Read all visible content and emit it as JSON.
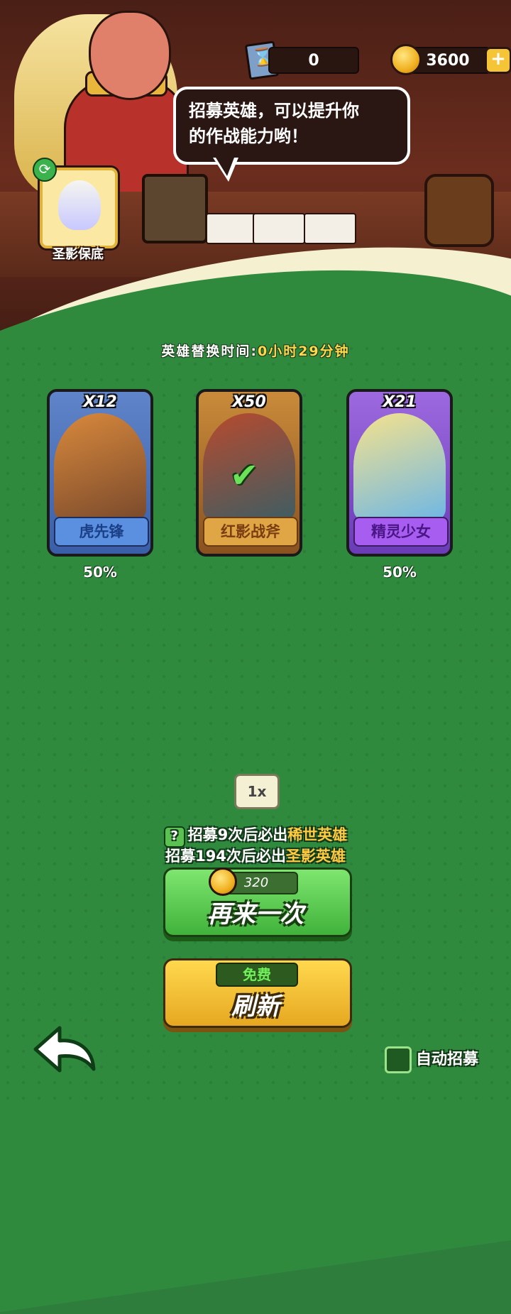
{
  "currency": {
    "tickets": "0",
    "coins": "3600",
    "add_label": "+"
  },
  "npc_speech": {
    "line1": "招募英雄，可以提升你",
    "line2": "的作战能力哟！"
  },
  "guarantee": {
    "label": "圣影保底"
  },
  "timer": {
    "label": "英雄替换时间:",
    "value": "0小时29分钟"
  },
  "heroes": [
    {
      "count": "X12",
      "name": "虎先锋",
      "rate": "50%",
      "color": "#5b90e0"
    },
    {
      "count": "X50",
      "name": "红影战斧",
      "rate": "",
      "color": "#e0a646",
      "selected": true
    },
    {
      "count": "X21",
      "name": "精灵少女",
      "rate": "50%",
      "color": "#a65df0"
    }
  ],
  "multiplier": "1x",
  "pity": {
    "line1_prefix": "招募9次后必出",
    "line1_highlight": "稀世英雄",
    "line2_prefix": "招募194次后必出",
    "line2_highlight": "圣影英雄"
  },
  "recruit_button": {
    "cost": "320",
    "label": "再来一次"
  },
  "refresh_button": {
    "badge": "免费",
    "label": "刷新"
  },
  "auto_recruit": {
    "label": "自动招募",
    "checked": false
  }
}
